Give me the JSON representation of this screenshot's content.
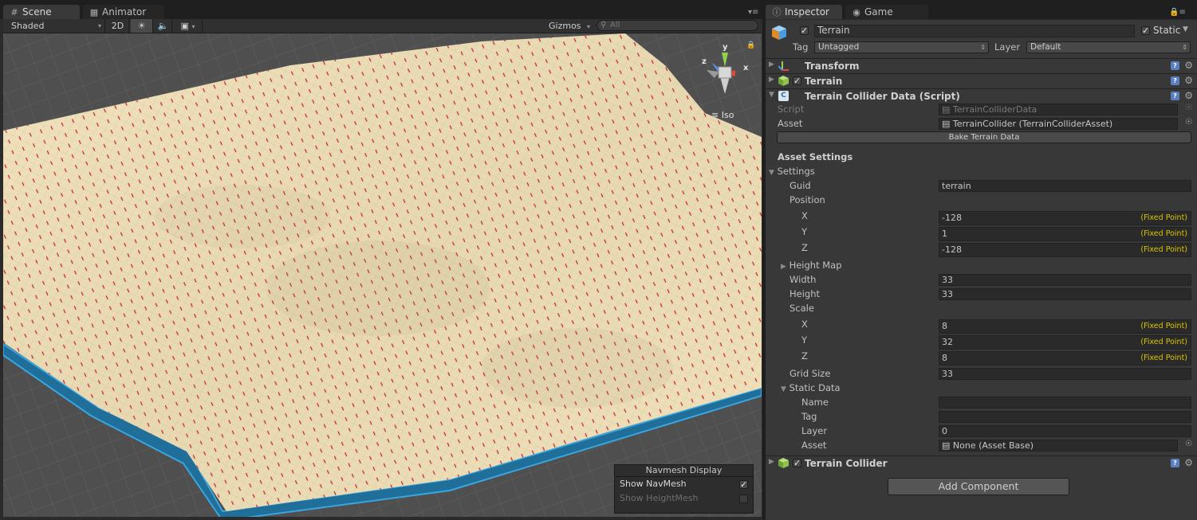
{
  "scene_tabs": {
    "scene": "Scene",
    "animator": "Animator"
  },
  "scene_toolbar": {
    "shading": "Shaded",
    "mode_2d": "2D",
    "gizmos": "Gizmos",
    "search_placeholder": "All"
  },
  "gizmo": {
    "y": "y",
    "x": "x",
    "z": "z",
    "projection": "Iso"
  },
  "navmesh_panel": {
    "title": "Navmesh Display",
    "show_navmesh": "Show NavMesh",
    "show_heightmesh": "Show HeightMesh"
  },
  "inspector_tabs": {
    "inspector": "Inspector",
    "game": "Game"
  },
  "object": {
    "name": "Terrain",
    "static_label": "Static",
    "tag_label": "Tag",
    "tag_value": "Untagged",
    "layer_label": "Layer",
    "layer_value": "Default"
  },
  "components": {
    "transform": "Transform",
    "terrain": "Terrain",
    "collider_data": "Terrain Collider Data (Script)",
    "terrain_collider": "Terrain Collider"
  },
  "script_field": {
    "script_label": "Script",
    "script_value": "TerrainColliderData",
    "asset_label": "Asset",
    "asset_value": "TerrainCollider (TerrainColliderAsset)"
  },
  "bake_button": "Bake Terrain Data",
  "asset_settings": {
    "heading": "Asset Settings",
    "settings": "Settings",
    "guid_label": "Guid",
    "guid_value": "terrain",
    "position_label": "Position",
    "pos_x": "-128",
    "pos_y": "1",
    "pos_z": "-128",
    "x": "X",
    "y": "Y",
    "z": "Z",
    "fixed_point": "(Fixed Point)",
    "height_map": "Height Map",
    "width_label": "Width",
    "width_value": "33",
    "height_label": "Height",
    "height_value": "33",
    "scale_label": "Scale",
    "scale_x": "8",
    "scale_y": "32",
    "scale_z": "8",
    "grid_size_label": "Grid Size",
    "grid_size_value": "33",
    "static_data": "Static Data",
    "name_label": "Name",
    "tag_label": "Tag",
    "layer_label": "Layer",
    "layer_value": "0",
    "asset_label": "Asset",
    "asset_value": "None (Asset Base)"
  },
  "add_component": "Add Component"
}
